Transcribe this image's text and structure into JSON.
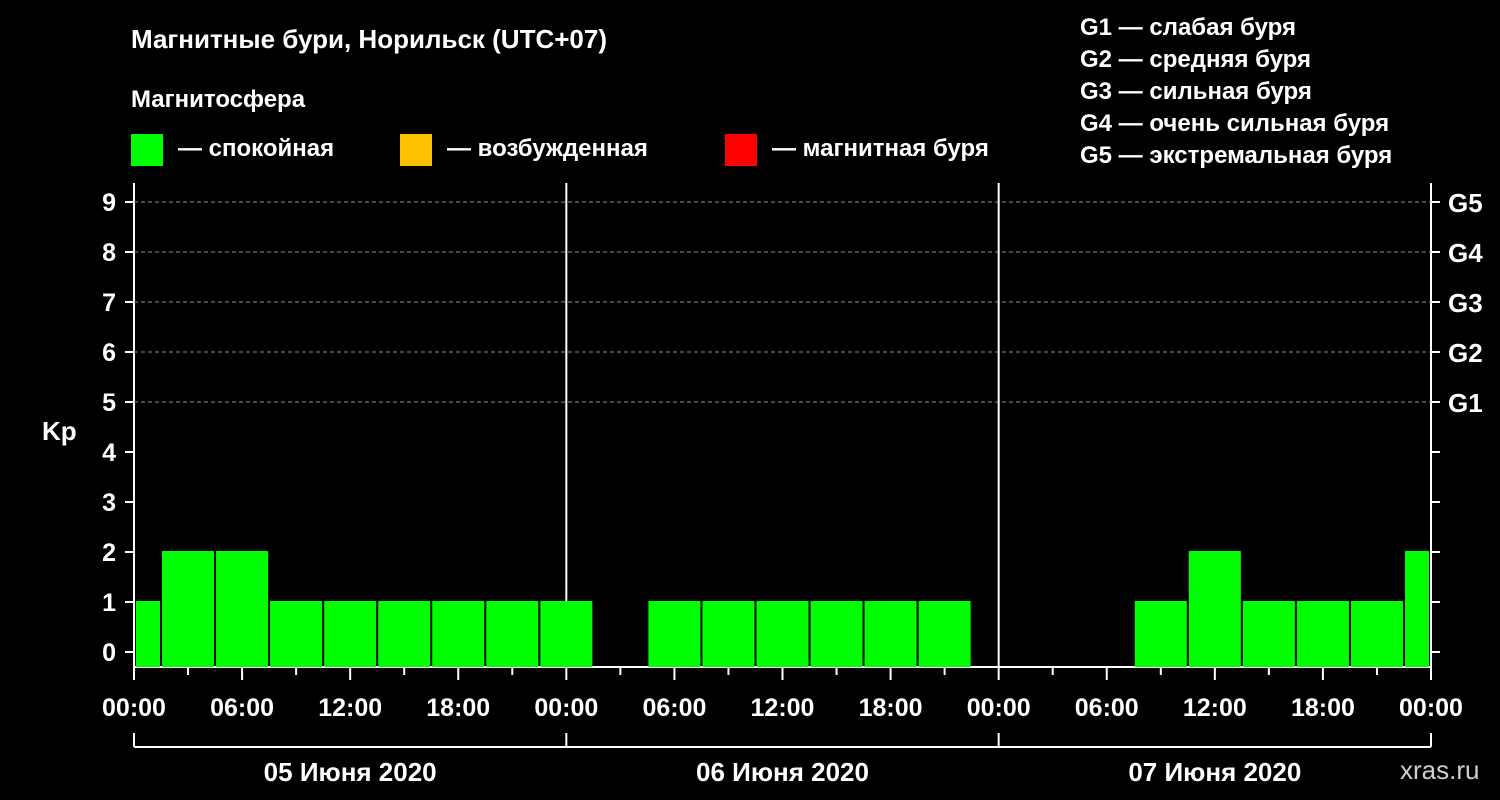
{
  "title": "Магнитные бури, Норильск (UTC+07)",
  "legend": {
    "heading": "Магнитосфера",
    "items": [
      {
        "label": "— спокойная",
        "color": "#00ff00"
      },
      {
        "label": "— возбужденная",
        "color": "#ffc000"
      },
      {
        "label": "— магнитная буря",
        "color": "#ff0000"
      }
    ],
    "storm_levels": [
      "G1 — слабая буря",
      "G2 — средняя буря",
      "G3 — сильная буря",
      "G4 — очень сильная буря",
      "G5 — экстремальная буря"
    ]
  },
  "watermark": "xras.ru",
  "chart_data": {
    "type": "bar",
    "ylabel": "Kp",
    "ylim": [
      0,
      9
    ],
    "y_ticks": [
      "0",
      "1",
      "2",
      "3",
      "4",
      "5",
      "6",
      "7",
      "8",
      "9"
    ],
    "right_ticks": [
      {
        "kp": 5,
        "label": "G1"
      },
      {
        "kp": 6,
        "label": "G2"
      },
      {
        "kp": 7,
        "label": "G3"
      },
      {
        "kp": 8,
        "label": "G4"
      },
      {
        "kp": 9,
        "label": "G5"
      }
    ],
    "grid": "dashed lines at Kp 5-9",
    "x_tick_labels": [
      "00:00",
      "06:00",
      "12:00",
      "18:00",
      "00:00",
      "06:00",
      "12:00",
      "18:00",
      "00:00",
      "06:00",
      "12:00",
      "18:00",
      "00:00"
    ],
    "days": [
      "05 Июня 2020",
      "06 Июня 2020",
      "07 Июня 2020"
    ],
    "interval_hours": 3,
    "series": [
      {
        "values": [
          1,
          2,
          2,
          1,
          1,
          1,
          1,
          1,
          1,
          0,
          1,
          1,
          1,
          1,
          1,
          1,
          0,
          0,
          0,
          1,
          2,
          1,
          1,
          1,
          2
        ]
      }
    ]
  }
}
